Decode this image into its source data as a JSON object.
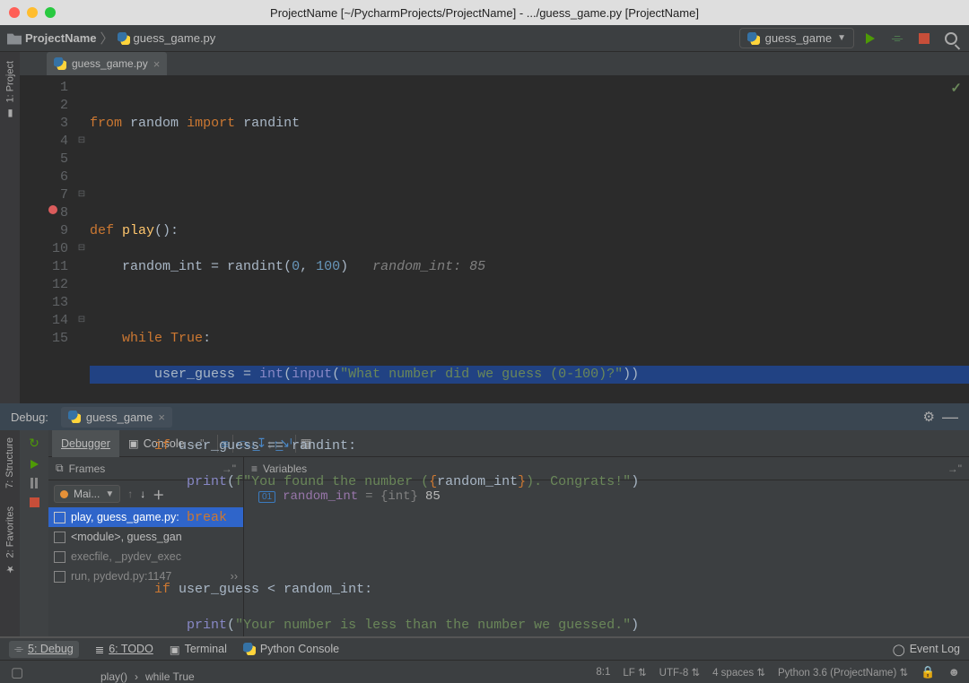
{
  "titlebar": {
    "title": "ProjectName [~/PycharmProjects/ProjectName] - .../guess_game.py [ProjectName]"
  },
  "breadcrumbs": {
    "project": "ProjectName",
    "file": "guess_game.py"
  },
  "run_config": {
    "name": "guess_game"
  },
  "side_tabs": {
    "project": "1: Project",
    "structure": "7: Structure",
    "favorites": "2: Favorites"
  },
  "editor_tab": {
    "name": "guess_game.py"
  },
  "editor": {
    "line_numbers": [
      "1",
      "2",
      "3",
      "4",
      "5",
      "6",
      "7",
      "8",
      "9",
      "10",
      "11",
      "12",
      "13",
      "14",
      "15"
    ],
    "crumb_func": "play()",
    "crumb_loop": "while True"
  },
  "code": {
    "l1a": "from",
    "l1b": "random",
    "l1c": "import",
    "l1d": "randint",
    "l4a": "def",
    "l4b": "play",
    "l4c": "():",
    "l5a": "random_int = ",
    "l5b": "randint",
    "l5c": "(",
    "l5d": "0",
    "l5e": ", ",
    "l5f": "100",
    "l5g": ")",
    "l5h": "random_int: 85",
    "l7a": "while",
    "l7b": "True",
    "l7c": ":",
    "l8a": "user_guess = ",
    "l8b": "int",
    "l8c": "(",
    "l8d": "input",
    "l8e": "(",
    "l8f": "\"What number did we guess (0-100)?\"",
    "l8g": "))",
    "l10a": "if",
    "l10b": " user_guess == randint:",
    "l11a": "print",
    "l11b": "(",
    "l11c": "f\"You found the number (",
    "l11d": "{",
    "l11e": "random_int",
    "l11f": "}",
    "l11g": "). Congrats!\"",
    "l11h": ")",
    "l12a": "break",
    "l14a": "if",
    "l14b": " user_guess < random_int:",
    "l15a": "print",
    "l15b": "(",
    "l15c": "\"Your number is less than the number we guessed.\"",
    "l15d": ")"
  },
  "debug": {
    "label": "Debug:",
    "tab": "guess_game",
    "tabs": {
      "debugger": "Debugger",
      "console": "Console"
    },
    "frames_label": "Frames",
    "vars_label": "Variables",
    "thread_sel": "Mai...",
    "frames": {
      "f1": "play, guess_game.py:",
      "f2": "<module>, guess_gan",
      "f3": "execfile, _pydev_exec",
      "f4": "run, pydevd.py:1147"
    },
    "var": {
      "name": "random_int",
      "type": "{int}",
      "val": "85",
      "eq": "="
    }
  },
  "bottom": {
    "debug_tab": "5: Debug",
    "todo_tab": "6: TODO",
    "terminal_tab": "Terminal",
    "pyconsole_tab": "Python Console",
    "event_log": "Event Log"
  },
  "status": {
    "pos": "8:1",
    "lf": "LF",
    "enc": "UTF-8",
    "indent": "4 spaces",
    "python": "Python 3.6 (ProjectName)"
  }
}
